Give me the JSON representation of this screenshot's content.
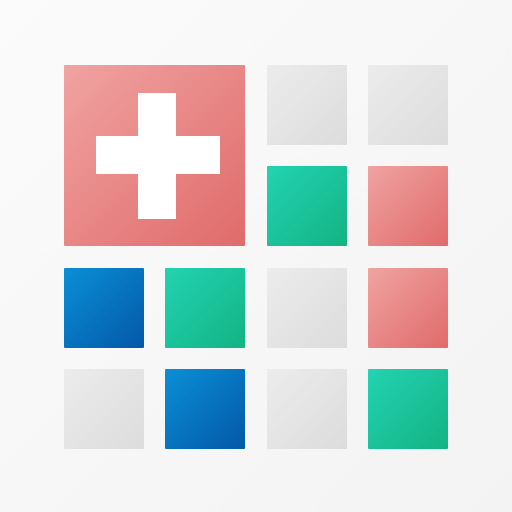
{
  "colors": {
    "background": "#f7f7f7",
    "gray": "#e4e4e4",
    "teal": "#1ac49a",
    "red": "#e88a89",
    "blue": "#0772be",
    "cross": "#ffffff"
  },
  "icon": {
    "name": "medical-cross-icon"
  },
  "tiles": [
    {
      "color": "red",
      "kind": "cross-tile"
    },
    {
      "color": "gray"
    },
    {
      "color": "gray"
    },
    {
      "color": "teal"
    },
    {
      "color": "red"
    },
    {
      "color": "blue"
    },
    {
      "color": "teal"
    },
    {
      "color": "gray"
    },
    {
      "color": "red"
    },
    {
      "color": "gray"
    },
    {
      "color": "blue"
    },
    {
      "color": "gray"
    },
    {
      "color": "teal"
    }
  ]
}
